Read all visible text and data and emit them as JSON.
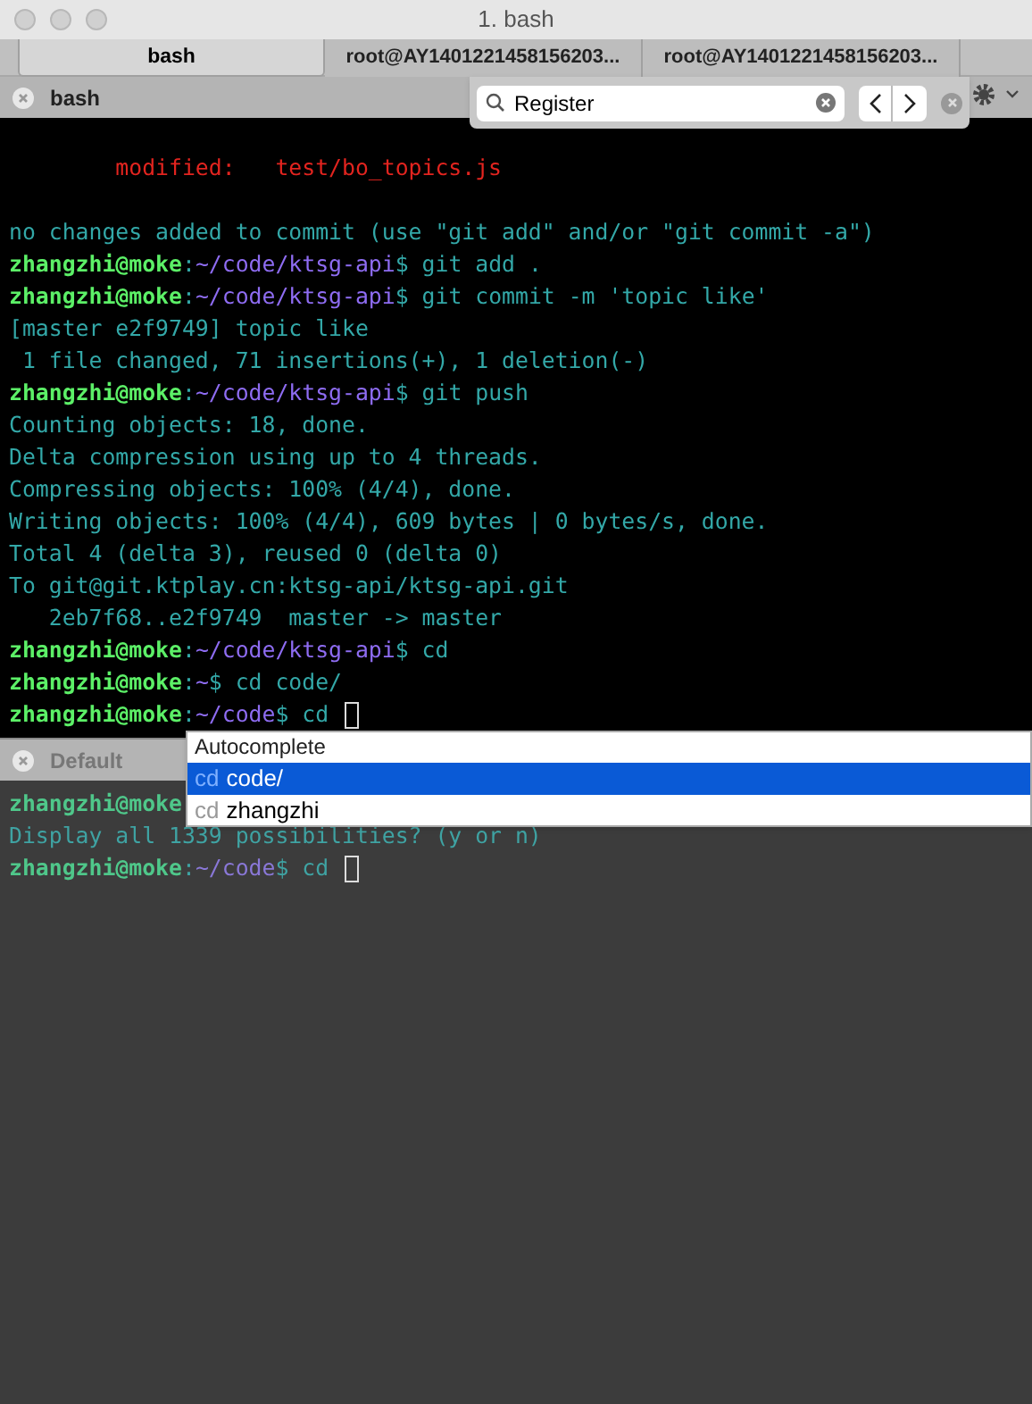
{
  "window": {
    "title": "1. bash"
  },
  "tabs": [
    {
      "label": "bash",
      "selected": true
    },
    {
      "label": "root@AY1401221458156203...",
      "selected": false
    },
    {
      "label": "root@AY1401221458156203...",
      "selected": false
    }
  ],
  "top_pane": {
    "title": "bash",
    "search": {
      "value": "Register"
    },
    "lines": [
      [
        {
          "kind": "error",
          "text": "        modified:   test/bo_topics.js"
        }
      ],
      [
        {
          "kind": "output",
          "text": "no changes added to commit (use \"git add\" and/or \"git commit -a\")"
        }
      ],
      [
        {
          "kind": "user",
          "text": "zhangzhi@moke"
        },
        {
          "kind": "output",
          "text": ":"
        },
        {
          "kind": "path",
          "text": "~/code/ktsg-api"
        },
        {
          "kind": "output",
          "text": "$ git add ."
        }
      ],
      [
        {
          "kind": "user",
          "text": "zhangzhi@moke"
        },
        {
          "kind": "output",
          "text": ":"
        },
        {
          "kind": "path",
          "text": "~/code/ktsg-api"
        },
        {
          "kind": "output",
          "text": "$ git commit -m 'topic like'"
        }
      ],
      [
        {
          "kind": "output",
          "text": "[master e2f9749] topic like"
        }
      ],
      [
        {
          "kind": "output",
          "text": " 1 file changed, 71 insertions(+), 1 deletion(-)"
        }
      ],
      [
        {
          "kind": "user",
          "text": "zhangzhi@moke"
        },
        {
          "kind": "output",
          "text": ":"
        },
        {
          "kind": "path",
          "text": "~/code/ktsg-api"
        },
        {
          "kind": "output",
          "text": "$ git push"
        }
      ],
      [
        {
          "kind": "output",
          "text": "Counting objects: 18, done."
        }
      ],
      [
        {
          "kind": "output",
          "text": "Delta compression using up to 4 threads."
        }
      ],
      [
        {
          "kind": "output",
          "text": "Compressing objects: 100% (4/4), done."
        }
      ],
      [
        {
          "kind": "output",
          "text": "Writing objects: 100% (4/4), 609 bytes | 0 bytes/s, done."
        }
      ],
      [
        {
          "kind": "output",
          "text": "Total 4 (delta 3), reused 0 (delta 0)"
        }
      ],
      [
        {
          "kind": "output",
          "text": "To git@git.ktplay.cn:ktsg-api/ktsg-api.git"
        }
      ],
      [
        {
          "kind": "output",
          "text": "   2eb7f68..e2f9749  master -> master"
        }
      ],
      [
        {
          "kind": "user",
          "text": "zhangzhi@moke"
        },
        {
          "kind": "output",
          "text": ":"
        },
        {
          "kind": "path",
          "text": "~/code/ktsg-api"
        },
        {
          "kind": "output",
          "text": "$ cd"
        }
      ],
      [
        {
          "kind": "user",
          "text": "zhangzhi@moke"
        },
        {
          "kind": "output",
          "text": ":"
        },
        {
          "kind": "path",
          "text": "~"
        },
        {
          "kind": "output",
          "text": "$ cd code/"
        }
      ],
      [
        {
          "kind": "user",
          "text": "zhangzhi@moke"
        },
        {
          "kind": "output",
          "text": ":"
        },
        {
          "kind": "path",
          "text": "~/code"
        },
        {
          "kind": "output",
          "text": "$ cd "
        },
        {
          "kind": "cursor"
        }
      ]
    ]
  },
  "bottom_pane": {
    "title": "Default",
    "lines": [
      [
        {
          "kind": "user",
          "text": "zhangzhi@moke"
        }
      ],
      [
        {
          "kind": "output",
          "text": "Display all 1339 possibilities? (y or n)"
        }
      ],
      [
        {
          "kind": "user",
          "text": "zhangzhi@moke"
        },
        {
          "kind": "output",
          "text": ":"
        },
        {
          "kind": "path",
          "text": "~/code"
        },
        {
          "kind": "output",
          "text": "$ cd "
        },
        {
          "kind": "cursor"
        }
      ]
    ]
  },
  "autocomplete": {
    "title": "Autocomplete",
    "items": [
      {
        "prefix": "cd",
        "text": "code/",
        "selected": true
      },
      {
        "prefix": "cd",
        "text": "zhangzhi",
        "selected": false
      }
    ]
  }
}
